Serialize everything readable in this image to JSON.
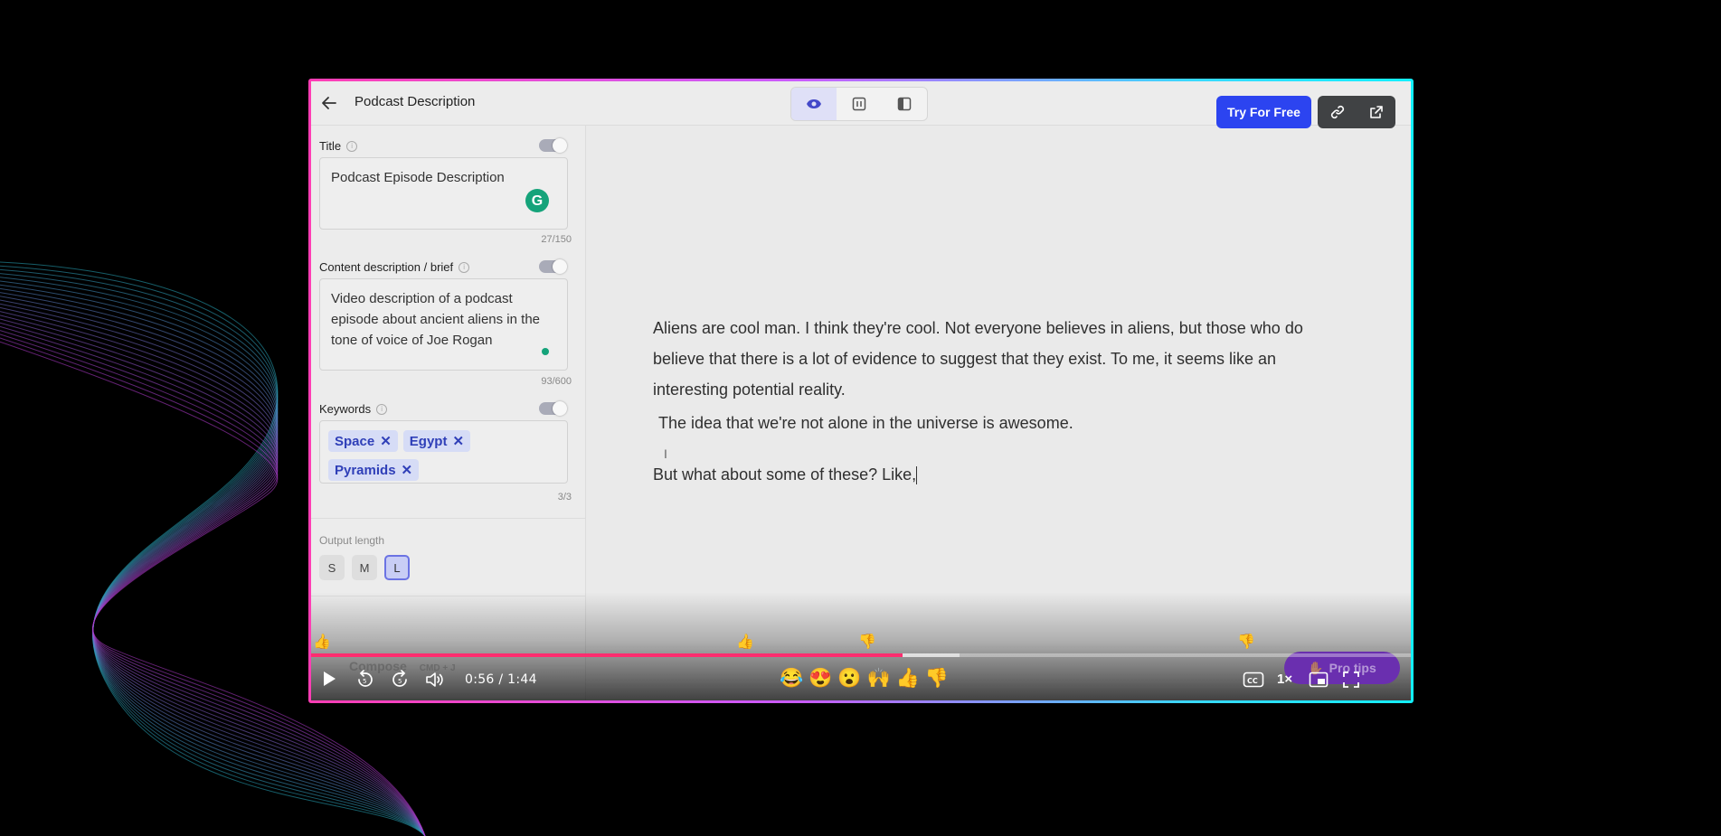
{
  "header": {
    "title": "Podcast Description",
    "try_label": "Try For Free"
  },
  "sidebar": {
    "title_field": {
      "label": "Title",
      "value": "Podcast Episode Description",
      "counter": "27/150"
    },
    "brief_field": {
      "label": "Content description / brief",
      "value": "Video description of a podcast episode about ancient aliens in the tone of voice of Joe Rogan",
      "counter": "93/600"
    },
    "keywords_field": {
      "label": "Keywords",
      "chips": [
        "Space",
        "Egypt",
        "Pyramids"
      ],
      "counter": "3/3"
    },
    "output_length": {
      "label": "Output length",
      "options": [
        "S",
        "M",
        "L"
      ],
      "selected": "L"
    }
  },
  "document": {
    "paragraph1": "Aliens are cool man. I think they're cool. Not everyone believes in aliens, but those who do believe that there is a lot of evidence to suggest that they exist. To me, it seems like an interesting potential reality.",
    "paragraph2": "The idea that we're not alone in the universe is awesome.",
    "paragraph3": "But what about some of these? Like,"
  },
  "video_player": {
    "time": "0:56 / 1:44",
    "progress_fraction": 0.538,
    "buffered_fraction": 0.59,
    "speed": "1×",
    "reactions": [
      "😂",
      "😍",
      "😮",
      "🙌",
      "👍",
      "👎"
    ],
    "pro_tips_label": "Pro tips",
    "accent_color": "#ff2d6f"
  },
  "colors": {
    "brand_button": "#2c44f0",
    "chip_text": "#2f3fb8",
    "frame_gradient_start": "#ff3db4",
    "frame_gradient_end": "#12f0ff"
  }
}
